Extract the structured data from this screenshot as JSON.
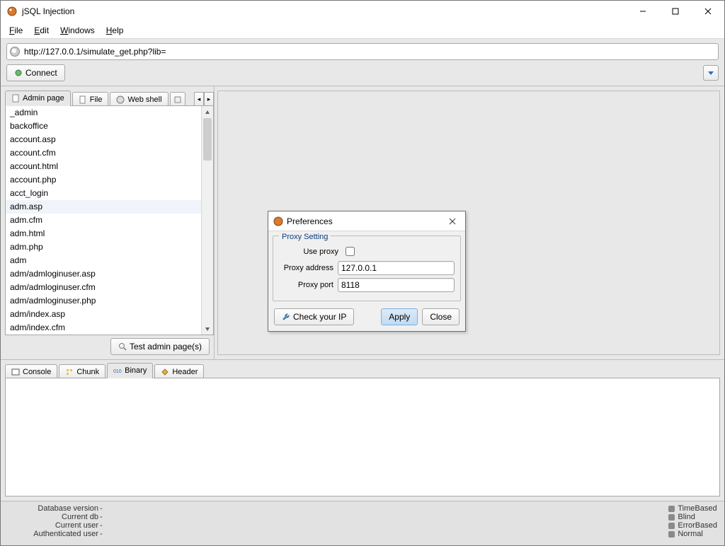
{
  "window": {
    "title": "jSQL Injection"
  },
  "menu": {
    "file": "File",
    "edit": "Edit",
    "windows": "Windows",
    "help": "Help"
  },
  "url": {
    "value": "http://127.0.0.1/simulate_get.php?lib="
  },
  "buttons": {
    "connect": "Connect",
    "testAdmin": "Test admin page(s)"
  },
  "tabs": {
    "left": {
      "admin": "Admin page",
      "file": "File",
      "webshell": "Web shell"
    },
    "console": {
      "console": "Console",
      "chunk": "Chunk",
      "binary": "Binary",
      "header": "Header"
    }
  },
  "adminList": [
    "_admin",
    "backoffice",
    "account.asp",
    "account.cfm",
    "account.html",
    "account.php",
    "acct_login",
    "adm.asp",
    "adm.cfm",
    "adm.html",
    "adm.php",
    "adm",
    "adm/admloginuser.asp",
    "adm/admloginuser.cfm",
    "adm/admloginuser.php",
    "adm/index.asp",
    "adm/index.cfm"
  ],
  "dialog": {
    "title": "Preferences",
    "legend": "Proxy Setting",
    "useProxyLabel": "Use proxy",
    "addrLabel": "Proxy address",
    "portLabel": "Proxy port",
    "addrValue": "127.0.0.1",
    "portValue": "8118",
    "checkIp": "Check your IP",
    "apply": "Apply",
    "close": "Close"
  },
  "status": {
    "dbVersionLabel": "Database version",
    "currentDbLabel": "Current db",
    "currentUserLabel": "Current user",
    "authUserLabel": "Authenticated user",
    "dash": "-",
    "timebased": "TimeBased",
    "blind": "Blind",
    "errorbased": "ErrorBased",
    "normal": "Normal"
  }
}
